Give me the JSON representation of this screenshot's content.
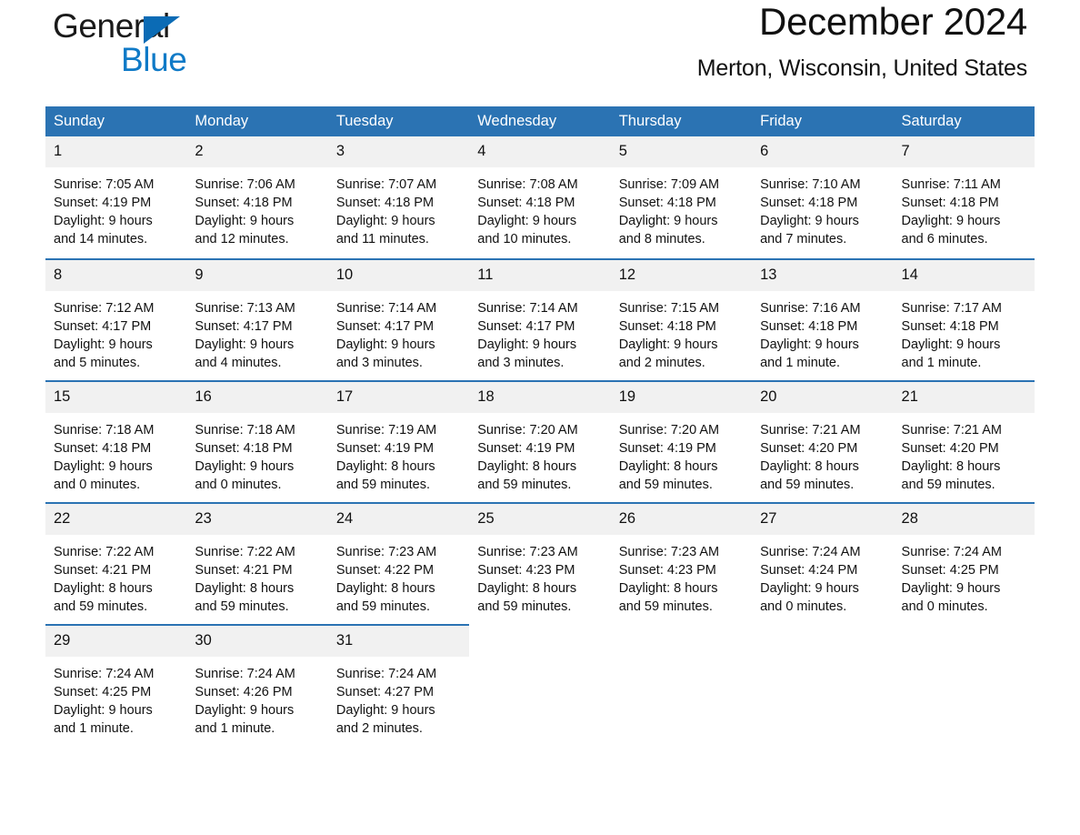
{
  "brand": {
    "word1": "General",
    "word2": "Blue",
    "triangle_color": "#0b6bb5",
    "blue_text_color": "#0f7ac7"
  },
  "header": {
    "title": "December 2024",
    "location": "Merton, Wisconsin, United States"
  },
  "theme": {
    "header_blue": "#2b73b3",
    "daynum_bg": "#f1f1f1",
    "text": "#111111"
  },
  "calendar": {
    "weekday_headers": [
      "Sunday",
      "Monday",
      "Tuesday",
      "Wednesday",
      "Thursday",
      "Friday",
      "Saturday"
    ],
    "weeks": [
      [
        {
          "day": "1",
          "sunrise": "Sunrise: 7:05 AM",
          "sunset": "Sunset: 4:19 PM",
          "daylight1": "Daylight: 9 hours",
          "daylight2": "and 14 minutes."
        },
        {
          "day": "2",
          "sunrise": "Sunrise: 7:06 AM",
          "sunset": "Sunset: 4:18 PM",
          "daylight1": "Daylight: 9 hours",
          "daylight2": "and 12 minutes."
        },
        {
          "day": "3",
          "sunrise": "Sunrise: 7:07 AM",
          "sunset": "Sunset: 4:18 PM",
          "daylight1": "Daylight: 9 hours",
          "daylight2": "and 11 minutes."
        },
        {
          "day": "4",
          "sunrise": "Sunrise: 7:08 AM",
          "sunset": "Sunset: 4:18 PM",
          "daylight1": "Daylight: 9 hours",
          "daylight2": "and 10 minutes."
        },
        {
          "day": "5",
          "sunrise": "Sunrise: 7:09 AM",
          "sunset": "Sunset: 4:18 PM",
          "daylight1": "Daylight: 9 hours",
          "daylight2": "and 8 minutes."
        },
        {
          "day": "6",
          "sunrise": "Sunrise: 7:10 AM",
          "sunset": "Sunset: 4:18 PM",
          "daylight1": "Daylight: 9 hours",
          "daylight2": "and 7 minutes."
        },
        {
          "day": "7",
          "sunrise": "Sunrise: 7:11 AM",
          "sunset": "Sunset: 4:18 PM",
          "daylight1": "Daylight: 9 hours",
          "daylight2": "and 6 minutes."
        }
      ],
      [
        {
          "day": "8",
          "sunrise": "Sunrise: 7:12 AM",
          "sunset": "Sunset: 4:17 PM",
          "daylight1": "Daylight: 9 hours",
          "daylight2": "and 5 minutes."
        },
        {
          "day": "9",
          "sunrise": "Sunrise: 7:13 AM",
          "sunset": "Sunset: 4:17 PM",
          "daylight1": "Daylight: 9 hours",
          "daylight2": "and 4 minutes."
        },
        {
          "day": "10",
          "sunrise": "Sunrise: 7:14 AM",
          "sunset": "Sunset: 4:17 PM",
          "daylight1": "Daylight: 9 hours",
          "daylight2": "and 3 minutes."
        },
        {
          "day": "11",
          "sunrise": "Sunrise: 7:14 AM",
          "sunset": "Sunset: 4:17 PM",
          "daylight1": "Daylight: 9 hours",
          "daylight2": "and 3 minutes."
        },
        {
          "day": "12",
          "sunrise": "Sunrise: 7:15 AM",
          "sunset": "Sunset: 4:18 PM",
          "daylight1": "Daylight: 9 hours",
          "daylight2": "and 2 minutes."
        },
        {
          "day": "13",
          "sunrise": "Sunrise: 7:16 AM",
          "sunset": "Sunset: 4:18 PM",
          "daylight1": "Daylight: 9 hours",
          "daylight2": "and 1 minute."
        },
        {
          "day": "14",
          "sunrise": "Sunrise: 7:17 AM",
          "sunset": "Sunset: 4:18 PM",
          "daylight1": "Daylight: 9 hours",
          "daylight2": "and 1 minute."
        }
      ],
      [
        {
          "day": "15",
          "sunrise": "Sunrise: 7:18 AM",
          "sunset": "Sunset: 4:18 PM",
          "daylight1": "Daylight: 9 hours",
          "daylight2": "and 0 minutes."
        },
        {
          "day": "16",
          "sunrise": "Sunrise: 7:18 AM",
          "sunset": "Sunset: 4:18 PM",
          "daylight1": "Daylight: 9 hours",
          "daylight2": "and 0 minutes."
        },
        {
          "day": "17",
          "sunrise": "Sunrise: 7:19 AM",
          "sunset": "Sunset: 4:19 PM",
          "daylight1": "Daylight: 8 hours",
          "daylight2": "and 59 minutes."
        },
        {
          "day": "18",
          "sunrise": "Sunrise: 7:20 AM",
          "sunset": "Sunset: 4:19 PM",
          "daylight1": "Daylight: 8 hours",
          "daylight2": "and 59 minutes."
        },
        {
          "day": "19",
          "sunrise": "Sunrise: 7:20 AM",
          "sunset": "Sunset: 4:19 PM",
          "daylight1": "Daylight: 8 hours",
          "daylight2": "and 59 minutes."
        },
        {
          "day": "20",
          "sunrise": "Sunrise: 7:21 AM",
          "sunset": "Sunset: 4:20 PM",
          "daylight1": "Daylight: 8 hours",
          "daylight2": "and 59 minutes."
        },
        {
          "day": "21",
          "sunrise": "Sunrise: 7:21 AM",
          "sunset": "Sunset: 4:20 PM",
          "daylight1": "Daylight: 8 hours",
          "daylight2": "and 59 minutes."
        }
      ],
      [
        {
          "day": "22",
          "sunrise": "Sunrise: 7:22 AM",
          "sunset": "Sunset: 4:21 PM",
          "daylight1": "Daylight: 8 hours",
          "daylight2": "and 59 minutes."
        },
        {
          "day": "23",
          "sunrise": "Sunrise: 7:22 AM",
          "sunset": "Sunset: 4:21 PM",
          "daylight1": "Daylight: 8 hours",
          "daylight2": "and 59 minutes."
        },
        {
          "day": "24",
          "sunrise": "Sunrise: 7:23 AM",
          "sunset": "Sunset: 4:22 PM",
          "daylight1": "Daylight: 8 hours",
          "daylight2": "and 59 minutes."
        },
        {
          "day": "25",
          "sunrise": "Sunrise: 7:23 AM",
          "sunset": "Sunset: 4:23 PM",
          "daylight1": "Daylight: 8 hours",
          "daylight2": "and 59 minutes."
        },
        {
          "day": "26",
          "sunrise": "Sunrise: 7:23 AM",
          "sunset": "Sunset: 4:23 PM",
          "daylight1": "Daylight: 8 hours",
          "daylight2": "and 59 minutes."
        },
        {
          "day": "27",
          "sunrise": "Sunrise: 7:24 AM",
          "sunset": "Sunset: 4:24 PM",
          "daylight1": "Daylight: 9 hours",
          "daylight2": "and 0 minutes."
        },
        {
          "day": "28",
          "sunrise": "Sunrise: 7:24 AM",
          "sunset": "Sunset: 4:25 PM",
          "daylight1": "Daylight: 9 hours",
          "daylight2": "and 0 minutes."
        }
      ],
      [
        {
          "day": "29",
          "sunrise": "Sunrise: 7:24 AM",
          "sunset": "Sunset: 4:25 PM",
          "daylight1": "Daylight: 9 hours",
          "daylight2": "and 1 minute."
        },
        {
          "day": "30",
          "sunrise": "Sunrise: 7:24 AM",
          "sunset": "Sunset: 4:26 PM",
          "daylight1": "Daylight: 9 hours",
          "daylight2": "and 1 minute."
        },
        {
          "day": "31",
          "sunrise": "Sunrise: 7:24 AM",
          "sunset": "Sunset: 4:27 PM",
          "daylight1": "Daylight: 9 hours",
          "daylight2": "and 2 minutes."
        },
        {
          "day": "",
          "sunrise": "",
          "sunset": "",
          "daylight1": "",
          "daylight2": "",
          "blank": true
        },
        {
          "day": "",
          "sunrise": "",
          "sunset": "",
          "daylight1": "",
          "daylight2": "",
          "blank": true
        },
        {
          "day": "",
          "sunrise": "",
          "sunset": "",
          "daylight1": "",
          "daylight2": "",
          "blank": true
        },
        {
          "day": "",
          "sunrise": "",
          "sunset": "",
          "daylight1": "",
          "daylight2": "",
          "blank": true
        }
      ]
    ]
  }
}
